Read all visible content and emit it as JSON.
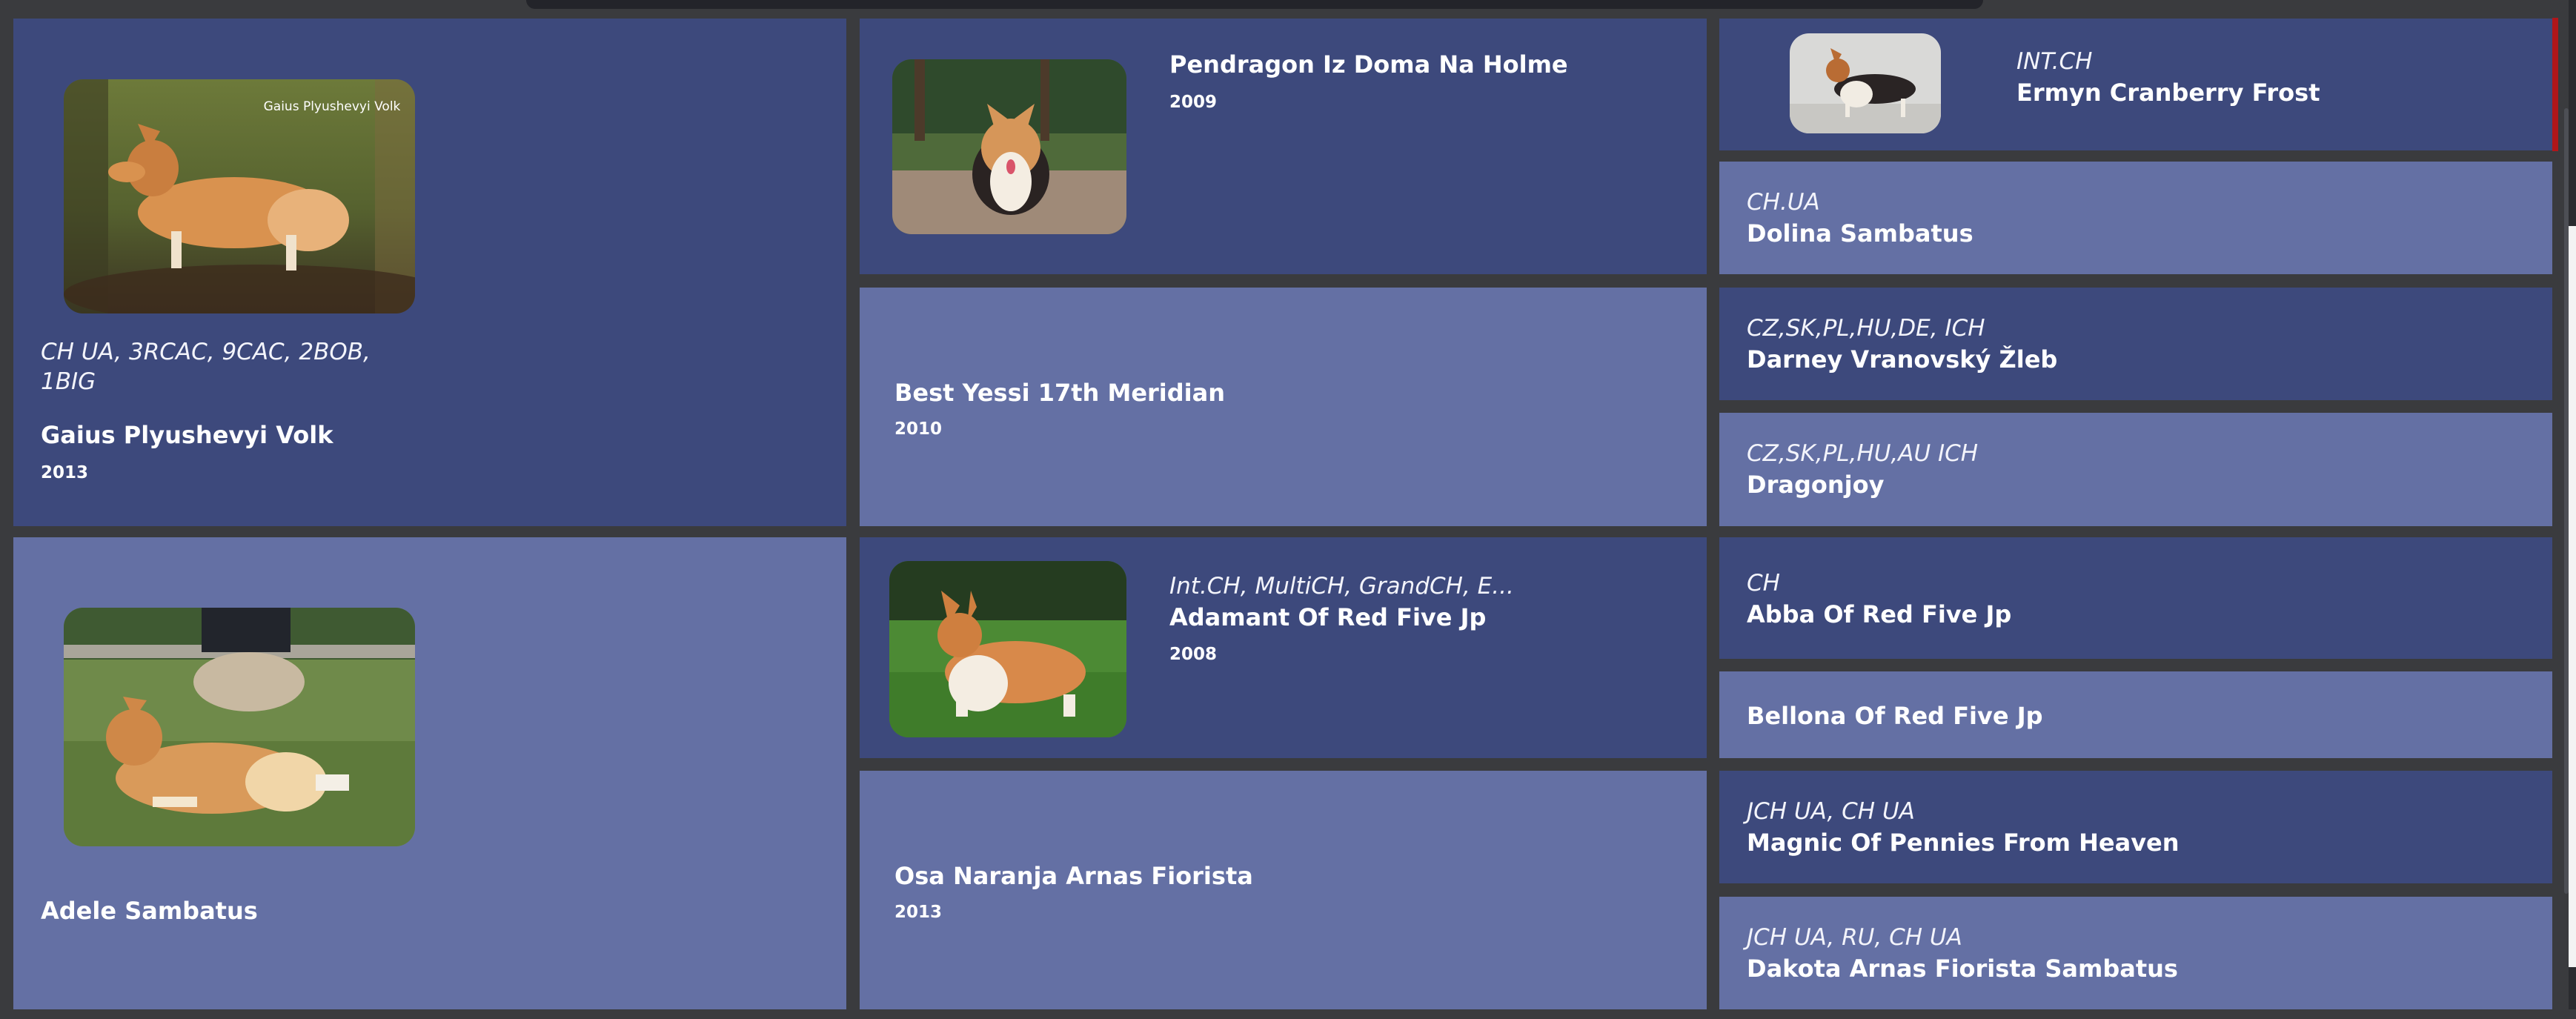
{
  "pedigree": {
    "subject": {
      "titles": "CH UA, 3RCAC, 9CAC, 2BOB, 1BIG",
      "name": "Gaius Plyushevyi Volk",
      "year": "2013",
      "watermark": "Gaius Plyushevyi Volk"
    },
    "dam": {
      "name": "Adele Sambatus"
    },
    "sire_sire": {
      "name": "Pendragon Iz Doma Na Holme",
      "year": "2009"
    },
    "sire_dam": {
      "name": "Best Yessi 17th Meridian",
      "year": "2010"
    },
    "dam_sire": {
      "titles": "Int.CH, MultiCH, GrandCH, E...",
      "name": "Adamant Of Red Five Jp",
      "year": "2008"
    },
    "dam_dam": {
      "name": "Osa Naranja Arnas Fiorista",
      "year": "2013"
    },
    "great_grandparents": [
      {
        "titles": "INT.CH",
        "name": "Ermyn Cranberry Frost"
      },
      {
        "titles": "CH.UA",
        "name": "Dolina Sambatus"
      },
      {
        "titles": "CZ,SK,PL,HU,DE, ICH",
        "name": "Darney Vranovský Žleb"
      },
      {
        "titles": "CZ,SK,PL,HU,AU ICH",
        "name": "Dragonjoy"
      },
      {
        "titles": "CH",
        "name": "Abba Of Red Five Jp"
      },
      {
        "titles": "",
        "name": "Bellona Of Red Five Jp"
      },
      {
        "titles": "JCH UA, CH UA",
        "name": "Magnic Of Pennies From Heaven"
      },
      {
        "titles": "JCH UA, RU, CH UA",
        "name": "Dakota Arnas Fiorista Sambatus"
      }
    ]
  },
  "colors": {
    "dark_cell": "#3d497c",
    "light_cell": "#6470a4",
    "background": "#3a3b3e"
  },
  "icons": {
    "photos": "corgi-photo"
  }
}
